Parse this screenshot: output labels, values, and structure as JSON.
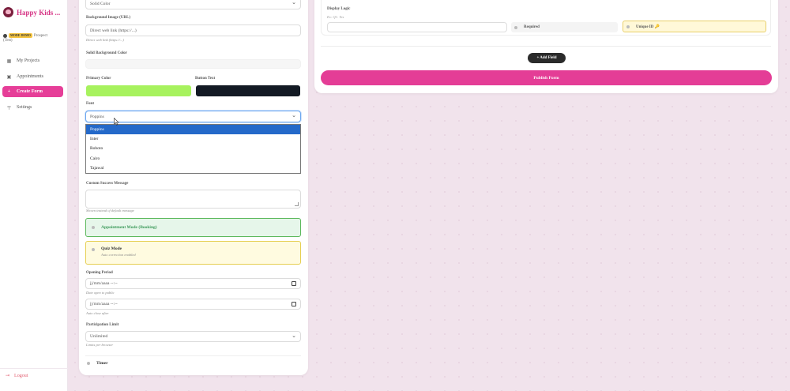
{
  "brand": {
    "name": "Happy Kids ...",
    "logo_icon": "heart-logo-icon"
  },
  "user": {
    "badge": "MODE DEMO",
    "name": "Prospect",
    "role": "(Test)"
  },
  "sidebar": {
    "items": [
      {
        "label": "My Projects",
        "icon": "grid-icon",
        "active": false
      },
      {
        "label": "Appointments",
        "icon": "calendar-icon",
        "active": false
      },
      {
        "label": "Create Form",
        "icon": "plus-icon",
        "active": true
      },
      {
        "label": "Settings",
        "icon": "paint-roller-icon",
        "active": false
      }
    ],
    "logout_label": "Logout"
  },
  "form_settings": {
    "background_type_value": "Solid Color",
    "background_image_label": "Background Image (URL)",
    "background_image_placeholder": "Direct web link (https://...)",
    "background_image_hint": "Direct web link (https://...)",
    "solid_bg_label": "Solid Background Color",
    "primary_color_label": "Primary Color",
    "primary_color": "#a7f25e",
    "button_text_label": "Button Text",
    "button_text_color": "#131a24",
    "font_label": "Font",
    "font_value": "Poppins",
    "font_options": [
      "Poppins",
      "Inter",
      "Roboto",
      "Cairo",
      "Tajawal"
    ],
    "success_message_label": "Custom Success Message",
    "success_message_hint": "Shown instead of default message",
    "appointment_mode_label": "Appointment Mode (Booking)",
    "quiz_mode_label": "Quiz Mode",
    "quiz_mode_hint": "Auto correction enabled",
    "opening_period_label": "Opening Period",
    "date_placeholder": "jj/mm/aaaa --:--",
    "open_hint": "Date open to public",
    "close_hint": "Auto close after",
    "participation_label": "Participation Limit",
    "participation_value": "Unlimited",
    "participation_hint": "Limits per browser",
    "timer_label": "Timer"
  },
  "right_panel": {
    "display_logic_label": "Display Logic",
    "display_logic_hint": "Ex: Q1: Yes",
    "required_label": "Required",
    "unique_id_label": "Unique ID 🔑",
    "add_field_label": "+ Add Field",
    "publish_label": "Publish Form"
  },
  "colors": {
    "accent": "#e43d96",
    "appointment_bg": "#e6f6ea",
    "appointment_border": "#5cb85c",
    "quiz_bg": "#fffbe0",
    "quiz_border": "#e6cf52"
  }
}
